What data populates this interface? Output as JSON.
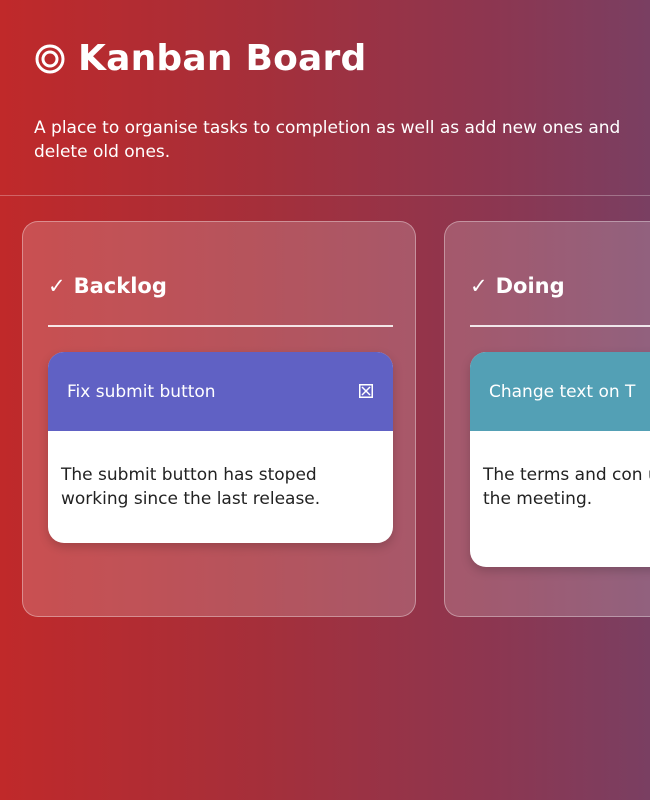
{
  "header": {
    "icon": "target-icon",
    "title": "Kanban Board",
    "description": "A place to organise tasks to completion as well as add new ones and delete old ones."
  },
  "columns": [
    {
      "title": "Backlog",
      "icon": "check-icon",
      "cards": [
        {
          "title": "Fix submit button",
          "body": "The submit button has stoped working since the last release.",
          "header_color": "#6061c4"
        }
      ]
    },
    {
      "title": "Doing",
      "icon": "check-icon",
      "cards": [
        {
          "title": "Change text on T",
          "body": "The terms and con updating as per the meeting.",
          "header_color": "#53a0b5"
        }
      ]
    }
  ],
  "colors": {
    "background_start": "#c0292a",
    "background_end": "#7a3f62",
    "card_body": "#ffffff"
  }
}
